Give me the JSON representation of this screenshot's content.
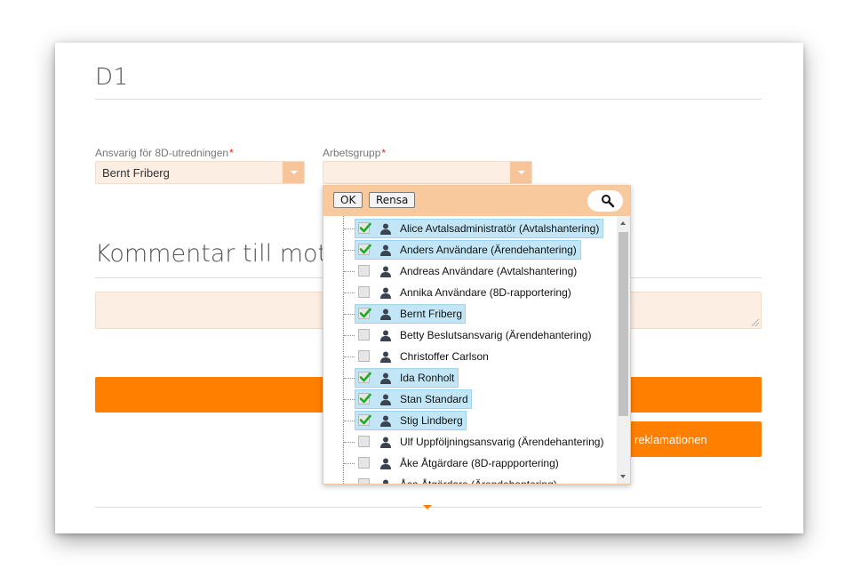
{
  "page": {
    "title": "D1"
  },
  "form": {
    "responsible": {
      "label": "Ansvarig för 8D-utredningen",
      "required_mark": "*",
      "value": "Bernt Friberg"
    },
    "workgroup": {
      "label": "Arbetsgrupp",
      "required_mark": "*",
      "value": ""
    }
  },
  "comment_section": {
    "title": "Kommentar till motta"
  },
  "buttons": {
    "secondary_label": "reklamationen"
  },
  "dropdown": {
    "ok_label": "OK",
    "clear_label": "Rensa",
    "search_icon": "search-icon",
    "items": [
      {
        "label": "Alice Avtalsadministratör (Avtalshantering)",
        "checked": true
      },
      {
        "label": "Anders Användare (Ärendehantering)",
        "checked": true
      },
      {
        "label": "Andreas Användare (Avtalshantering)",
        "checked": false
      },
      {
        "label": "Annika Användare (8D-rapportering)",
        "checked": false
      },
      {
        "label": "Bernt Friberg",
        "checked": true
      },
      {
        "label": "Betty Beslutsansvarig (Ärendehantering)",
        "checked": false
      },
      {
        "label": "Christoffer Carlson",
        "checked": false
      },
      {
        "label": "Ida Ronholt",
        "checked": true
      },
      {
        "label": "Stan Standard",
        "checked": true
      },
      {
        "label": "Stig Lindberg",
        "checked": true
      },
      {
        "label": "Ulf Uppföljningsansvarig (Ärendehantering)",
        "checked": false
      },
      {
        "label": "Åke Åtgärdare (8D-rappportering)",
        "checked": false
      },
      {
        "label": "Åsa Åtgärdare (Ärendehantering)",
        "checked": false
      }
    ]
  },
  "colors": {
    "accent": "#ff7f00",
    "field_bg": "#fdeee3",
    "selected_bg": "#c3e6f6",
    "header_bg": "#f8c99d"
  }
}
